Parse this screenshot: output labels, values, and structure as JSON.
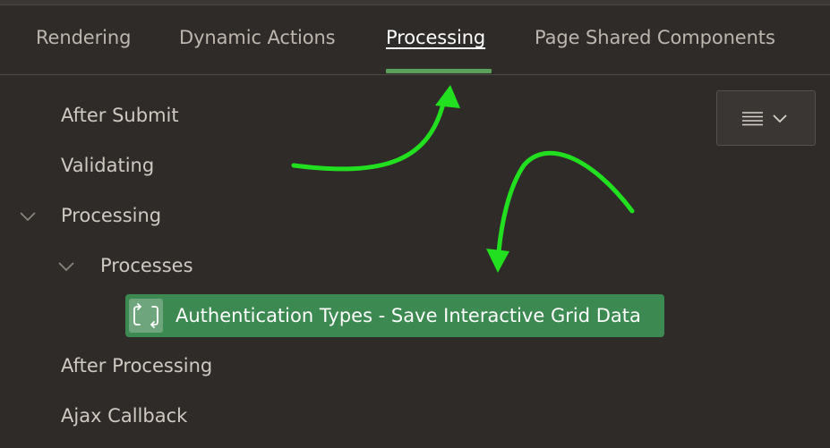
{
  "tabs": [
    {
      "label": "Rendering",
      "active": false
    },
    {
      "label": "Dynamic Actions",
      "active": false
    },
    {
      "label": "Processing",
      "active": true
    },
    {
      "label": "Page Shared Components",
      "active": false
    }
  ],
  "tree": {
    "after_submit": "After Submit",
    "validating": "Validating",
    "processing": "Processing",
    "processes": "Processes",
    "selected_process": "Authentication Types - Save Interactive Grid Data",
    "after_processing": "After Processing",
    "ajax_callback": "Ajax Callback"
  },
  "icons": {
    "process": "process-refresh-icon",
    "menu": "hamburger-menu-icon",
    "dropdown": "chevron-down-icon"
  },
  "colors": {
    "background": "#2e2b28",
    "active_tab_indicator": "#5aa05a",
    "selected_node": "#3c8a52",
    "annotation_arrow": "#22e01f"
  }
}
